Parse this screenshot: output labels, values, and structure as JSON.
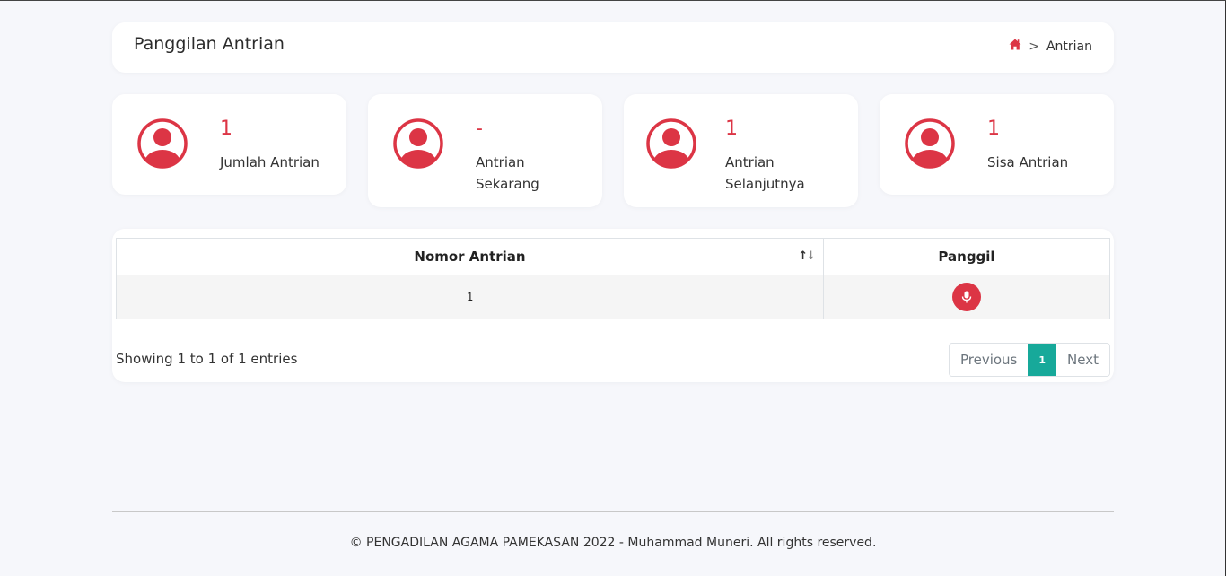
{
  "header": {
    "title": "Panggilan Antrian",
    "breadcrumb": {
      "home_icon": "home-icon",
      "separator": ">",
      "current": "Antrian"
    }
  },
  "stats": [
    {
      "value": "1",
      "label": "Jumlah Antrian",
      "icon": "user-circle-icon"
    },
    {
      "value": "-",
      "label": "Antrian Sekarang",
      "icon": "user-circle-icon"
    },
    {
      "value": "1",
      "label": "Antrian Selanjutnya",
      "icon": "user-circle-icon"
    },
    {
      "value": "1",
      "label": "Sisa Antrian",
      "icon": "user-circle-icon"
    }
  ],
  "table": {
    "columns": [
      "Nomor Antrian",
      "Panggil"
    ],
    "rows": [
      {
        "nomor": "1",
        "action_icon": "microphone-icon"
      }
    ],
    "info": "Showing 1 to 1 of 1 entries",
    "pagination": {
      "previous": "Previous",
      "current_page": "1",
      "next": "Next"
    }
  },
  "footer": {
    "text": "© PENGADILAN AGAMA PAMEKASAN 2022 - Muhammad Muneri. All rights reserved."
  },
  "colors": {
    "accent": "#dc3545",
    "page_active": "#17a99a",
    "background": "#f6f7fb"
  }
}
